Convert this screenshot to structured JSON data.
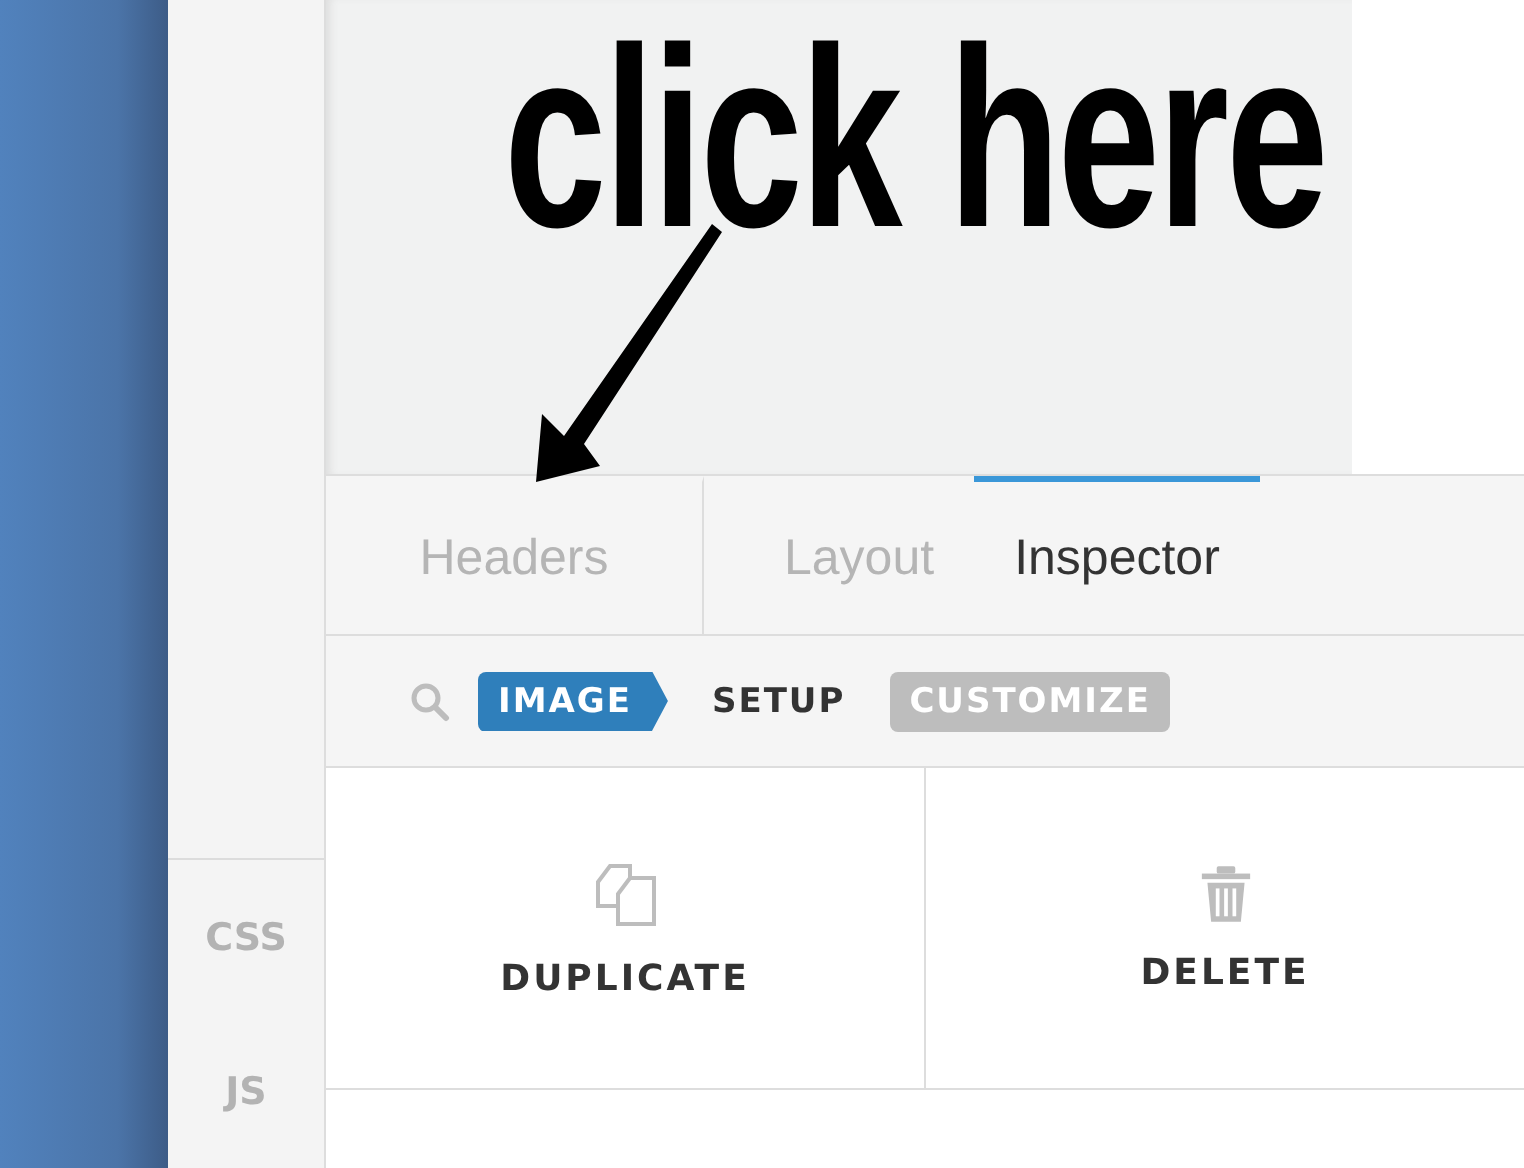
{
  "annotation": {
    "text": "click here"
  },
  "sidebar": {
    "items": [
      {
        "label": "CSS"
      },
      {
        "label": "JS"
      }
    ]
  },
  "tabs": [
    {
      "label": "Headers",
      "selected": false
    },
    {
      "label": "Layout",
      "selected": false
    },
    {
      "label": "Inspector",
      "selected": true
    }
  ],
  "breadcrumb": [
    {
      "label": "IMAGE",
      "kind": "current"
    },
    {
      "label": "SETUP",
      "kind": "plain"
    },
    {
      "label": "CUSTOMIZE",
      "kind": "pill"
    }
  ],
  "actions": [
    {
      "label": "DUPLICATE",
      "kind": "duplicate"
    },
    {
      "label": "DELETE",
      "kind": "delete"
    }
  ]
}
